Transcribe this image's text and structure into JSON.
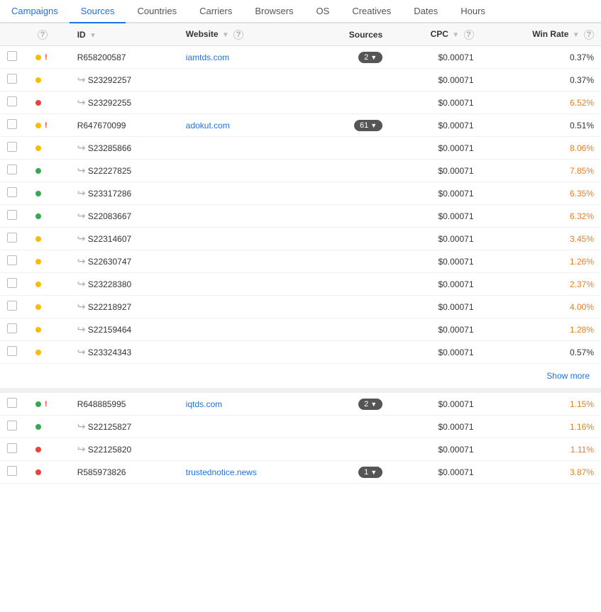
{
  "tabs": [
    {
      "id": "campaigns",
      "label": "Campaigns",
      "active": false
    },
    {
      "id": "sources",
      "label": "Sources",
      "active": true
    },
    {
      "id": "countries",
      "label": "Countries",
      "active": false
    },
    {
      "id": "carriers",
      "label": "Carriers",
      "active": false
    },
    {
      "id": "browsers",
      "label": "Browsers",
      "active": false
    },
    {
      "id": "os",
      "label": "OS",
      "active": false
    },
    {
      "id": "creatives",
      "label": "Creatives",
      "active": false
    },
    {
      "id": "dates",
      "label": "Dates",
      "active": false
    },
    {
      "id": "hours",
      "label": "Hours",
      "active": false
    }
  ],
  "columns": [
    {
      "id": "id",
      "label": "ID",
      "sortable": true
    },
    {
      "id": "website",
      "label": "Website",
      "sortable": true
    },
    {
      "id": "sources",
      "label": "Sources",
      "sortable": false
    },
    {
      "id": "cpc",
      "label": "CPC",
      "sortable": true
    },
    {
      "id": "winrate",
      "label": "Win Rate",
      "sortable": true
    }
  ],
  "group1": {
    "rows": [
      {
        "id": "R658200587",
        "status": "yellow",
        "warn": true,
        "sub": false,
        "website": "iamtds.com",
        "sources_count": "2",
        "has_sources": true,
        "cpc": "$0.00071",
        "win_rate": "0.37%",
        "win_rate_color": "normal"
      },
      {
        "id": "S23292257",
        "status": "yellow",
        "warn": false,
        "sub": true,
        "website": "",
        "sources_count": "",
        "has_sources": false,
        "cpc": "$0.00071",
        "win_rate": "0.37%",
        "win_rate_color": "normal"
      },
      {
        "id": "S23292255",
        "status": "red",
        "warn": false,
        "sub": true,
        "website": "",
        "sources_count": "",
        "has_sources": false,
        "cpc": "$0.00071",
        "win_rate": "6.52%",
        "win_rate_color": "orange"
      },
      {
        "id": "R647670099",
        "status": "yellow",
        "warn": true,
        "sub": false,
        "website": "adokut.com",
        "sources_count": "61",
        "has_sources": true,
        "cpc": "$0.00071",
        "win_rate": "0.51%",
        "win_rate_color": "normal"
      },
      {
        "id": "S23285866",
        "status": "yellow",
        "warn": false,
        "sub": true,
        "website": "",
        "sources_count": "",
        "has_sources": false,
        "cpc": "$0.00071",
        "win_rate": "8.06%",
        "win_rate_color": "orange"
      },
      {
        "id": "S22227825",
        "status": "green",
        "warn": false,
        "sub": true,
        "website": "",
        "sources_count": "",
        "has_sources": false,
        "cpc": "$0.00071",
        "win_rate": "7.85%",
        "win_rate_color": "orange"
      },
      {
        "id": "S23317286",
        "status": "green",
        "warn": false,
        "sub": true,
        "website": "",
        "sources_count": "",
        "has_sources": false,
        "cpc": "$0.00071",
        "win_rate": "6.35%",
        "win_rate_color": "orange"
      },
      {
        "id": "S22083667",
        "status": "green",
        "warn": false,
        "sub": true,
        "website": "",
        "sources_count": "",
        "has_sources": false,
        "cpc": "$0.00071",
        "win_rate": "6.32%",
        "win_rate_color": "orange"
      },
      {
        "id": "S22314607",
        "status": "yellow",
        "warn": false,
        "sub": true,
        "website": "",
        "sources_count": "",
        "has_sources": false,
        "cpc": "$0.00071",
        "win_rate": "3.45%",
        "win_rate_color": "orange"
      },
      {
        "id": "S22630747",
        "status": "yellow",
        "warn": false,
        "sub": true,
        "website": "",
        "sources_count": "",
        "has_sources": false,
        "cpc": "$0.00071",
        "win_rate": "1.26%",
        "win_rate_color": "orange"
      },
      {
        "id": "S23228380",
        "status": "yellow",
        "warn": false,
        "sub": true,
        "website": "",
        "sources_count": "",
        "has_sources": false,
        "cpc": "$0.00071",
        "win_rate": "2.37%",
        "win_rate_color": "orange"
      },
      {
        "id": "S22218927",
        "status": "yellow",
        "warn": false,
        "sub": true,
        "website": "",
        "sources_count": "",
        "has_sources": false,
        "cpc": "$0.00071",
        "win_rate": "4.00%",
        "win_rate_color": "orange"
      },
      {
        "id": "S22159464",
        "status": "yellow",
        "warn": false,
        "sub": true,
        "website": "",
        "sources_count": "",
        "has_sources": false,
        "cpc": "$0.00071",
        "win_rate": "1.28%",
        "win_rate_color": "orange"
      },
      {
        "id": "S23324343",
        "status": "yellow",
        "warn": false,
        "sub": true,
        "website": "",
        "sources_count": "",
        "has_sources": false,
        "cpc": "$0.00071",
        "win_rate": "0.57%",
        "win_rate_color": "normal"
      }
    ],
    "show_more": "Show more"
  },
  "group2": {
    "rows": [
      {
        "id": "R648885995",
        "status": "green",
        "warn": true,
        "sub": false,
        "website": "iqtds.com",
        "sources_count": "2",
        "has_sources": true,
        "cpc": "$0.00071",
        "win_rate": "1.15%",
        "win_rate_color": "orange"
      },
      {
        "id": "S22125827",
        "status": "green",
        "warn": false,
        "sub": true,
        "website": "",
        "sources_count": "",
        "has_sources": false,
        "cpc": "$0.00071",
        "win_rate": "1.16%",
        "win_rate_color": "orange"
      },
      {
        "id": "S22125820",
        "status": "red",
        "warn": false,
        "sub": true,
        "website": "",
        "sources_count": "",
        "has_sources": false,
        "cpc": "$0.00071",
        "win_rate": "1.11%",
        "win_rate_color": "orange"
      },
      {
        "id": "R585973826",
        "status": "red",
        "warn": false,
        "sub": false,
        "website": "trustednotice.news",
        "sources_count": "1",
        "has_sources": true,
        "cpc": "$0.00071",
        "win_rate": "3.87%",
        "win_rate_color": "orange"
      }
    ]
  }
}
